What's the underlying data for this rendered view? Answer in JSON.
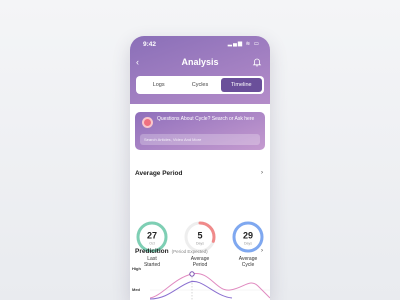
{
  "status_bar": {
    "time": "9:42",
    "icons": "▂▄▆ ≋ ▭"
  },
  "header": {
    "title": "Analysis"
  },
  "tabs": [
    {
      "label": "Logs"
    },
    {
      "label": "Cycles"
    },
    {
      "label": "Timeline"
    }
  ],
  "ask_card": {
    "question": "Questions About Cycle? Search or Ask here",
    "search_placeholder": "Search Articles, Video And More"
  },
  "average_period": {
    "title": "Average Period",
    "stats": [
      {
        "value": "27",
        "unit": "Oct",
        "label_line1": "Last",
        "label_line2": "Started",
        "color": "#7ecfb4",
        "progress": 1.0
      },
      {
        "value": "5",
        "unit": "Days",
        "label_line1": "Average",
        "label_line2": "Period",
        "color": "#f08a8a",
        "progress": 0.3
      },
      {
        "value": "29",
        "unit": "Days",
        "label_line1": "Average",
        "label_line2": "Cycle",
        "color": "#7fa8f0",
        "progress": 1.0
      }
    ]
  },
  "prediction": {
    "title": "Predicition",
    "subtitle": "(Period Expected)",
    "y_levels": [
      "High",
      "Med"
    ],
    "accent": "#7a4fb0"
  }
}
